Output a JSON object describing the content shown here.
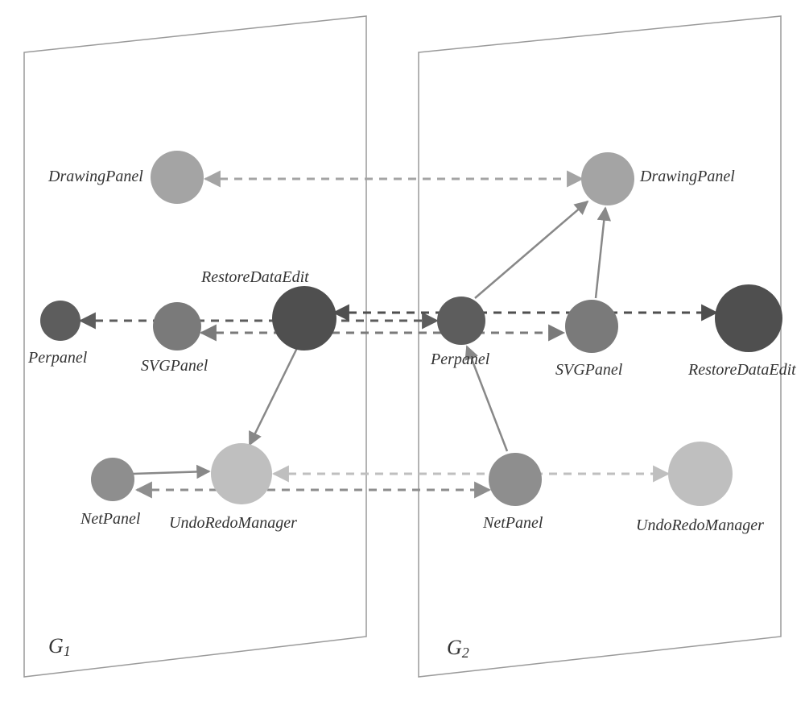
{
  "graphs": {
    "g1": {
      "label_letter": "G",
      "label_sub": "1"
    },
    "g2": {
      "label_letter": "G",
      "label_sub": "2"
    }
  },
  "nodes": {
    "g1": {
      "drawingPanel": {
        "label": "DrawingPanel"
      },
      "perpanel": {
        "label": "Perpanel"
      },
      "svgPanel": {
        "label": "SVGPanel"
      },
      "restoreDataEdit": {
        "label": "RestoreDataEdit"
      },
      "netPanel": {
        "label": "NetPanel"
      },
      "undoRedoManager": {
        "label": "UndoRedoManager"
      }
    },
    "g2": {
      "drawingPanel": {
        "label": "DrawingPanel"
      },
      "perpanel": {
        "label": "Perpanel"
      },
      "svgPanel": {
        "label": "SVGPanel"
      },
      "restoreDataEdit": {
        "label": "RestoreDataEdit"
      },
      "netPanel": {
        "label": "NetPanel"
      },
      "undoRedoManager": {
        "label": "UndoRedoManager"
      }
    }
  },
  "colors": {
    "drawingPanel": "#a4a4a4",
    "perpanel": "#5d5d5d",
    "svgPanel": "#7a7a7a",
    "restoreDataEdit": "#4f4f4f",
    "netPanel": "#8e8e8e",
    "undoRedoManager": "#bfbfbf",
    "panelStroke": "#9a9a9a",
    "edgeSolid": "#888888"
  }
}
